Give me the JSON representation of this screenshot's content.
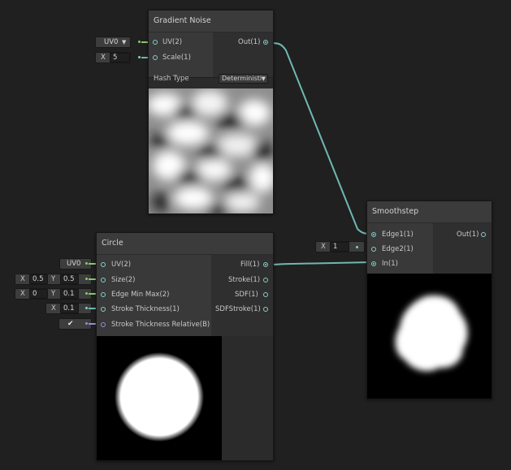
{
  "gradient_noise": {
    "title": "Gradient Noise",
    "inputs": {
      "uv": "UV(2)",
      "scale": "Scale(1)"
    },
    "output": "Out(1)",
    "uv_value": "UV0",
    "scale_axis": "X",
    "scale_value": "5",
    "hash_type_label": "Hash Type",
    "hash_type_value": "Deterministi"
  },
  "circle": {
    "title": "Circle",
    "inputs": {
      "uv": "UV(2)",
      "size": "Size(2)",
      "edge": "Edge Min Max(2)",
      "stroke": "Stroke Thickness(1)",
      "stroke_rel": "Stroke Thickness Relative(B)"
    },
    "outputs": {
      "fill": "Fill(1)",
      "stroke": "Stroke(1)",
      "sdf": "SDF(1)",
      "sdf_stroke": "SDFStroke(1)"
    },
    "uv_value": "UV0",
    "size": {
      "x_label": "X",
      "x": "0.5",
      "y_label": "Y",
      "y": "0.5"
    },
    "edge": {
      "x_label": "X",
      "x": "0",
      "y_label": "Y",
      "y": "0.1"
    },
    "stroke_axis": "X",
    "stroke_value": "0.1",
    "stroke_relative_checked": true,
    "check_mark": "✔"
  },
  "smoothstep": {
    "title": "Smoothstep",
    "inputs": {
      "edge1": "Edge1(1)",
      "edge2": "Edge2(1)",
      "in": "In(1)"
    },
    "output": "Out(1)",
    "edge2_axis": "X",
    "edge2_value": "1"
  },
  "colors": {
    "background": "#202020",
    "node_body": "#2b2b2b",
    "node_header": "#3b3b3b",
    "float_port": "#85d0cc",
    "bool_port": "#9f8ad8",
    "vec2_wire": "#8ac86c"
  }
}
